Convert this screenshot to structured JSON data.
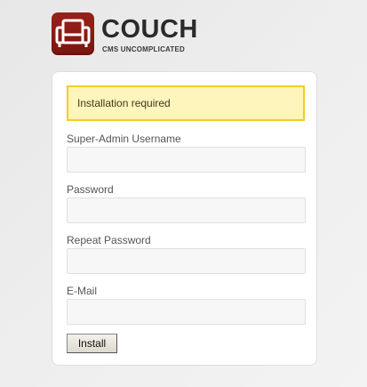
{
  "logo": {
    "title": "COUCH",
    "tagline": "CMS UNCOMPLICATED",
    "icon": "couch-icon",
    "color": "#8b1b14"
  },
  "notice": {
    "text": "Installation required",
    "background": "#fdf5bc",
    "border": "#f1cd28"
  },
  "form": {
    "fields": [
      {
        "label": "Super-Admin Username",
        "value": "",
        "placeholder": ""
      },
      {
        "label": "Password",
        "value": "",
        "placeholder": ""
      },
      {
        "label": "Repeat Password",
        "value": "",
        "placeholder": ""
      },
      {
        "label": "E-Mail",
        "value": "",
        "placeholder": ""
      }
    ],
    "submit_label": "Install"
  }
}
